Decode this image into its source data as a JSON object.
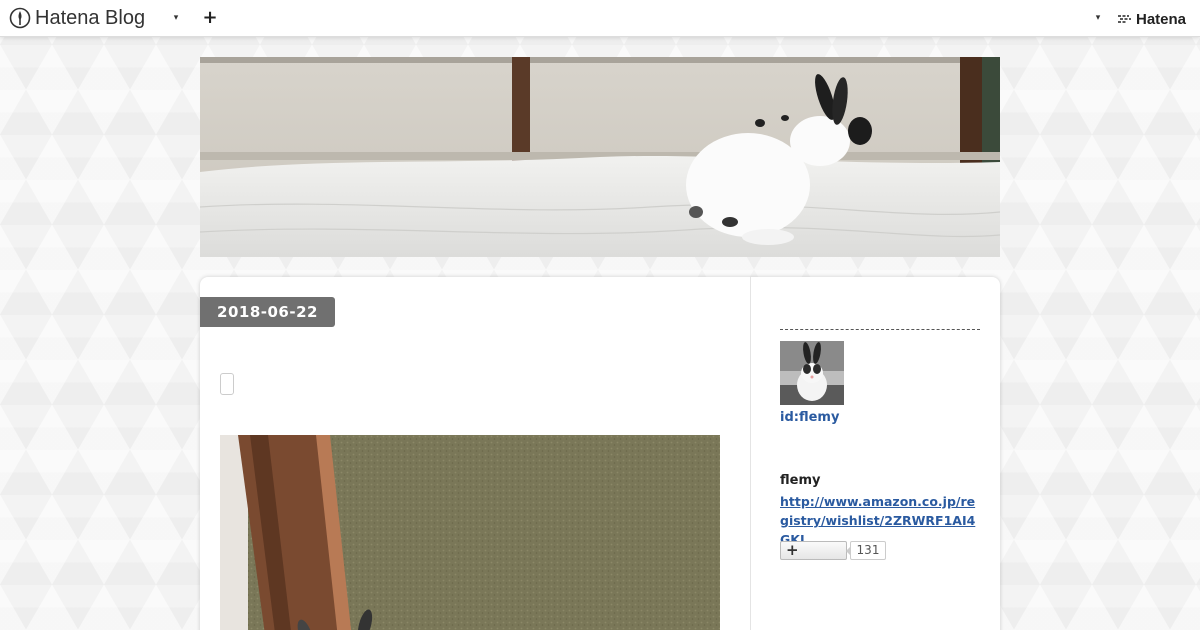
{
  "navbar": {
    "brand": "Hatena Blog",
    "brand_icon": "hatena-blog-logo-icon",
    "dropdown_icon": "caret-down-icon",
    "add_icon": "plus-icon",
    "right_dropdown_icon": "caret-down-icon",
    "hatena_label": "Hatena",
    "hatena_icon": "hatena-logo-icon"
  },
  "entry": {
    "date": "2018-06-22"
  },
  "sidebar": {
    "profile_id": "id:flemy",
    "name": "flemy",
    "link": "http://www.amazon.co.jp/registry/wishlist/2ZRWRF1AI4GKJ",
    "reader_button_icon": "plus-icon",
    "reader_count": "131"
  },
  "colors": {
    "date_badge": "#707070",
    "link": "#2a5aa0",
    "background": "#f3f3f3"
  }
}
